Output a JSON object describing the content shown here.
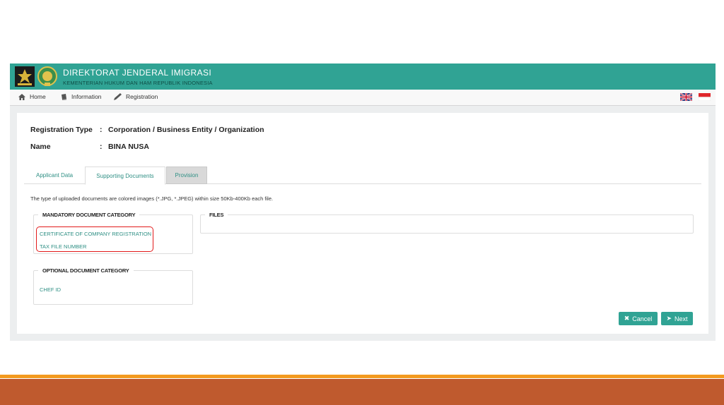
{
  "header": {
    "title": "DIREKTORAT JENDERAL IMIGRASI",
    "subtitle": "KEMENTERIAN HUKUM DAN HAM REPUBLIK INDONESIA",
    "logo_color": "#1b1b1b"
  },
  "nav": {
    "items": [
      {
        "label": "Home",
        "icon": "home-icon"
      },
      {
        "label": "Information",
        "icon": "book-icon"
      },
      {
        "label": "Registration",
        "icon": "pencil-icon"
      }
    ],
    "languages": [
      "english-flag",
      "indonesian-flag"
    ]
  },
  "info": {
    "registration_type_label": "Registration Type",
    "registration_type_value": "Corporation / Business Entity / Organization",
    "name_label": "Name",
    "name_value": "BINA NUSA",
    "colon": ":"
  },
  "tabs": [
    {
      "label": "Applicant Data",
      "active": false
    },
    {
      "label": "Supporting Documents",
      "active": true
    },
    {
      "label": "Provision",
      "active": false
    }
  ],
  "upload_note": "The type of uploaded documents are colored images (*.JPG, *.JPEG) within size 50Kb-400Kb each file.",
  "mandatory": {
    "legend": "MANDATORY DOCUMENT CATEGORY",
    "items": [
      "CERTIFICATE OF COMPANY REGISTRATION",
      "TAX FILE NUMBER"
    ]
  },
  "optional": {
    "legend": "OPTIONAL DOCUMENT CATEGORY",
    "items": [
      "CHEF ID"
    ]
  },
  "files": {
    "legend": "FILES"
  },
  "buttons": {
    "cancel": "Cancel",
    "next": "Next"
  },
  "colors": {
    "accent": "#30a394",
    "highlight": "#e21a1a",
    "footer_orange": "#f39a1f",
    "footer_rust": "#bf5a2e"
  }
}
